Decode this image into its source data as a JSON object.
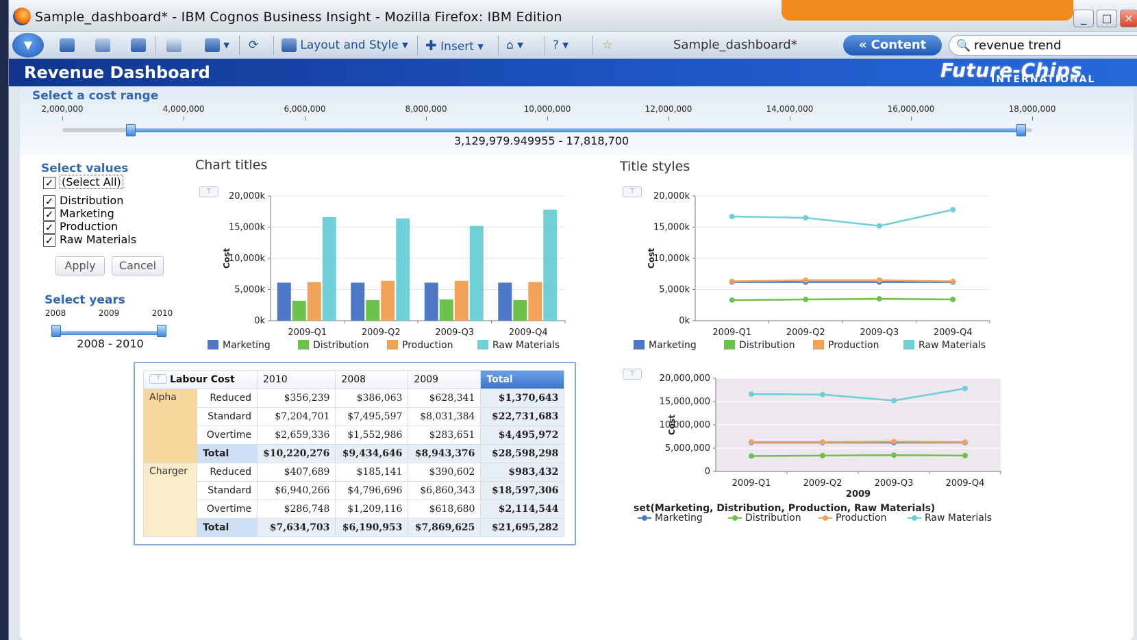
{
  "window": {
    "title": "Sample_dashboard* - IBM Cognos Business Insight - Mozilla Firefox: IBM Edition",
    "minimize": "_",
    "maximize": "□",
    "close": "×"
  },
  "toolbar": {
    "layout_label": "Layout and Style",
    "insert_label": "Insert",
    "breadcrumb": "Sample_dashboard*",
    "content_button": "« Content",
    "search_value": "revenue trend"
  },
  "header": {
    "title": "Revenue Dashboard",
    "logo_main": "Future-Chips",
    "logo_sub": "INTERNATIONAL"
  },
  "cost_range": {
    "label": "Select a cost range",
    "ticks": [
      "2,000,000",
      "4,000,000",
      "6,000,000",
      "8,000,000",
      "10,000,000",
      "12,000,000",
      "14,000,000",
      "16,000,000",
      "18,000,000"
    ],
    "min": 2000000,
    "max": 18000000,
    "low": 3129979.949955,
    "high": 17818700,
    "readout": "3,129,979.949955 - 17,818,700"
  },
  "select_values": {
    "label": "Select values",
    "items": [
      {
        "label": "(Select All)",
        "checked": true
      },
      {
        "label": "Distribution",
        "checked": true
      },
      {
        "label": "Marketing",
        "checked": true
      },
      {
        "label": "Production",
        "checked": true
      },
      {
        "label": "Raw Materials",
        "checked": true
      }
    ],
    "apply": "Apply",
    "cancel": "Cancel"
  },
  "select_years": {
    "label": "Select years",
    "ticks": [
      "2008",
      "2009",
      "2010"
    ],
    "readout": "2008 - 2010"
  },
  "colors": {
    "Marketing": "#4d79c7",
    "Distribution": "#6cc24a",
    "Production": "#f2a35a",
    "Raw Materials": "#6fcfd6"
  },
  "chart_data": [
    {
      "type": "bar",
      "title": "Chart titles",
      "ylabel": "Cost",
      "ylim": [
        0,
        20000
      ],
      "yticks": [
        "0k",
        "5,000k",
        "10,000k",
        "15,000k",
        "20,000k"
      ],
      "categories": [
        "2009-Q1",
        "2009-Q2",
        "2009-Q3",
        "2009-Q4"
      ],
      "series": [
        {
          "name": "Marketing",
          "values": [
            6100,
            6100,
            6100,
            6100
          ]
        },
        {
          "name": "Distribution",
          "values": [
            3200,
            3300,
            3400,
            3300
          ]
        },
        {
          "name": "Production",
          "values": [
            6200,
            6400,
            6400,
            6200
          ]
        },
        {
          "name": "Raw Materials",
          "values": [
            16600,
            16400,
            15200,
            17800
          ]
        }
      ],
      "legend": "bottom"
    },
    {
      "type": "line",
      "title": "Title styles",
      "ylabel": "Cost",
      "ylim": [
        0,
        20000
      ],
      "yticks": [
        "0k",
        "5,000k",
        "10,000k",
        "15,000k",
        "20,000k"
      ],
      "categories": [
        "2009-Q1",
        "2009-Q2",
        "2009-Q3",
        "2009-Q4"
      ],
      "series": [
        {
          "name": "Marketing",
          "values": [
            6200,
            6200,
            6200,
            6200
          ]
        },
        {
          "name": "Distribution",
          "values": [
            3300,
            3400,
            3500,
            3400
          ]
        },
        {
          "name": "Production",
          "values": [
            6300,
            6500,
            6500,
            6300
          ]
        },
        {
          "name": "Raw Materials",
          "values": [
            16700,
            16500,
            15200,
            17800
          ]
        }
      ],
      "legend": "bottom"
    },
    {
      "type": "line",
      "ylabel": "Cost",
      "xlabel": "2009",
      "ylim": [
        0,
        20000000
      ],
      "yticks": [
        "0",
        "5,000,000",
        "10,000,000",
        "15,000,000",
        "20,000,000"
      ],
      "categories": [
        "2009-Q1",
        "2009-Q2",
        "2009-Q3",
        "2009-Q4"
      ],
      "legend_title": "set(Marketing, Distribution, Production, Raw Materials)",
      "series": [
        {
          "name": "Marketing",
          "values": [
            6200000,
            6200000,
            6200000,
            6200000
          ]
        },
        {
          "name": "Distribution",
          "values": [
            3300000,
            3400000,
            3500000,
            3400000
          ]
        },
        {
          "name": "Production",
          "values": [
            6300000,
            6300000,
            6400000,
            6300000
          ]
        },
        {
          "name": "Raw Materials",
          "values": [
            16600000,
            16500000,
            15200000,
            17800000
          ]
        }
      ],
      "legend": "bottom"
    }
  ],
  "table": {
    "corner": "Labour Cost",
    "columns": [
      "2010",
      "2008",
      "2009",
      "Total"
    ],
    "groups": [
      {
        "name": "Alpha",
        "rows": [
          {
            "label": "Reduced",
            "values": [
              "$356,239",
              "$386,063",
              "$628,341",
              "$1,370,643"
            ]
          },
          {
            "label": "Standard",
            "values": [
              "$7,204,701",
              "$7,495,597",
              "$8,031,384",
              "$22,731,683"
            ]
          },
          {
            "label": "Overtime",
            "values": [
              "$2,659,336",
              "$1,552,986",
              "$283,651",
              "$4,495,972"
            ]
          },
          {
            "label": "Total",
            "values": [
              "$10,220,276",
              "$9,434,646",
              "$8,943,376",
              "$28,598,298"
            ]
          }
        ]
      },
      {
        "name": "Charger",
        "rows": [
          {
            "label": "Reduced",
            "values": [
              "$407,689",
              "$185,141",
              "$390,602",
              "$983,432"
            ]
          },
          {
            "label": "Standard",
            "values": [
              "$6,940,266",
              "$4,796,696",
              "$6,860,343",
              "$18,597,306"
            ]
          },
          {
            "label": "Overtime",
            "values": [
              "$286,748",
              "$1,209,116",
              "$618,680",
              "$2,114,544"
            ]
          },
          {
            "label": "Total",
            "values": [
              "$7,634,703",
              "$6,190,953",
              "$7,869,625",
              "$21,695,282"
            ]
          }
        ]
      }
    ]
  }
}
